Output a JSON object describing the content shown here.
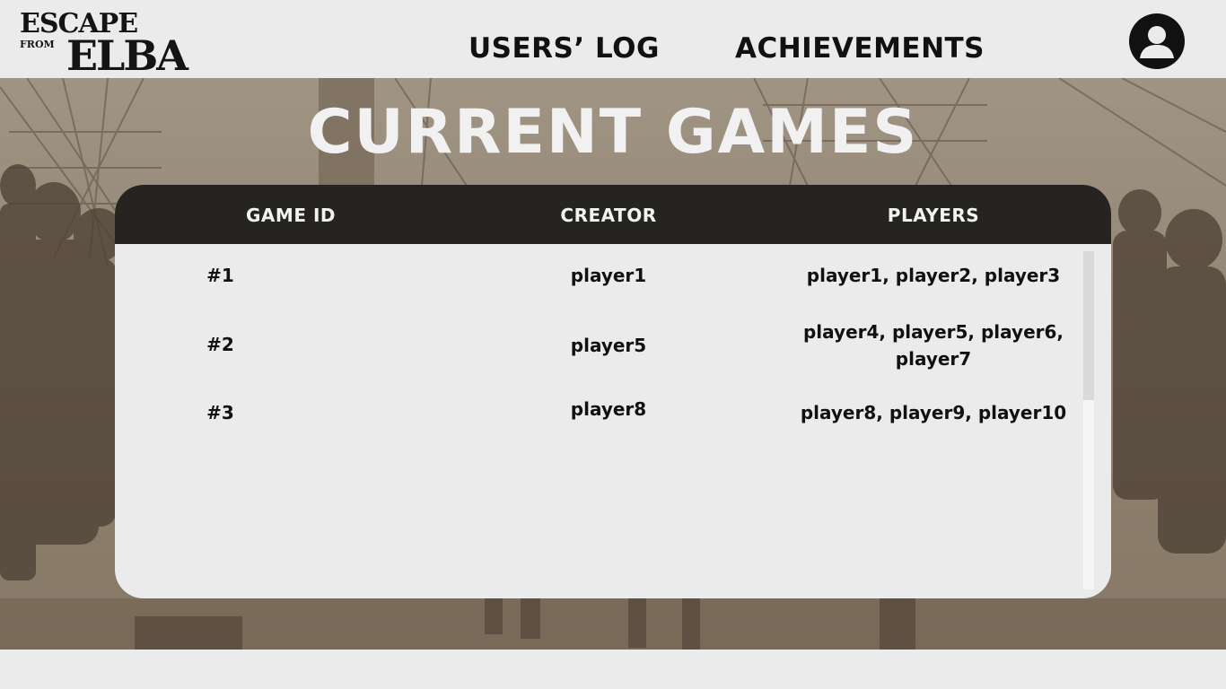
{
  "header": {
    "logo_line1": "ESCAPE",
    "logo_small": "FROM",
    "logo_line2": "ELBA",
    "nav": [
      {
        "label": "USERS’ LOG"
      },
      {
        "label": "ACHIEVEMENTS"
      }
    ],
    "profile_icon": "user-avatar-icon"
  },
  "main": {
    "title": "CURRENT GAMES",
    "table": {
      "columns": [
        "GAME ID",
        "CREATOR",
        "PLAYERS"
      ],
      "rows": [
        {
          "id": "#1",
          "creator": "player1",
          "players": "player1, player2, player3"
        },
        {
          "id": "#2",
          "creator": "player5",
          "players": "player4, player5, player6, player7"
        },
        {
          "id": "#3",
          "creator": "player8",
          "players": "player8, player9, player10"
        }
      ]
    }
  },
  "colors": {
    "page_bg": "#ebebeb",
    "table_header_bg": "#262421",
    "scene_tone": "#8e806e",
    "title_text": "#f1f1f1"
  }
}
